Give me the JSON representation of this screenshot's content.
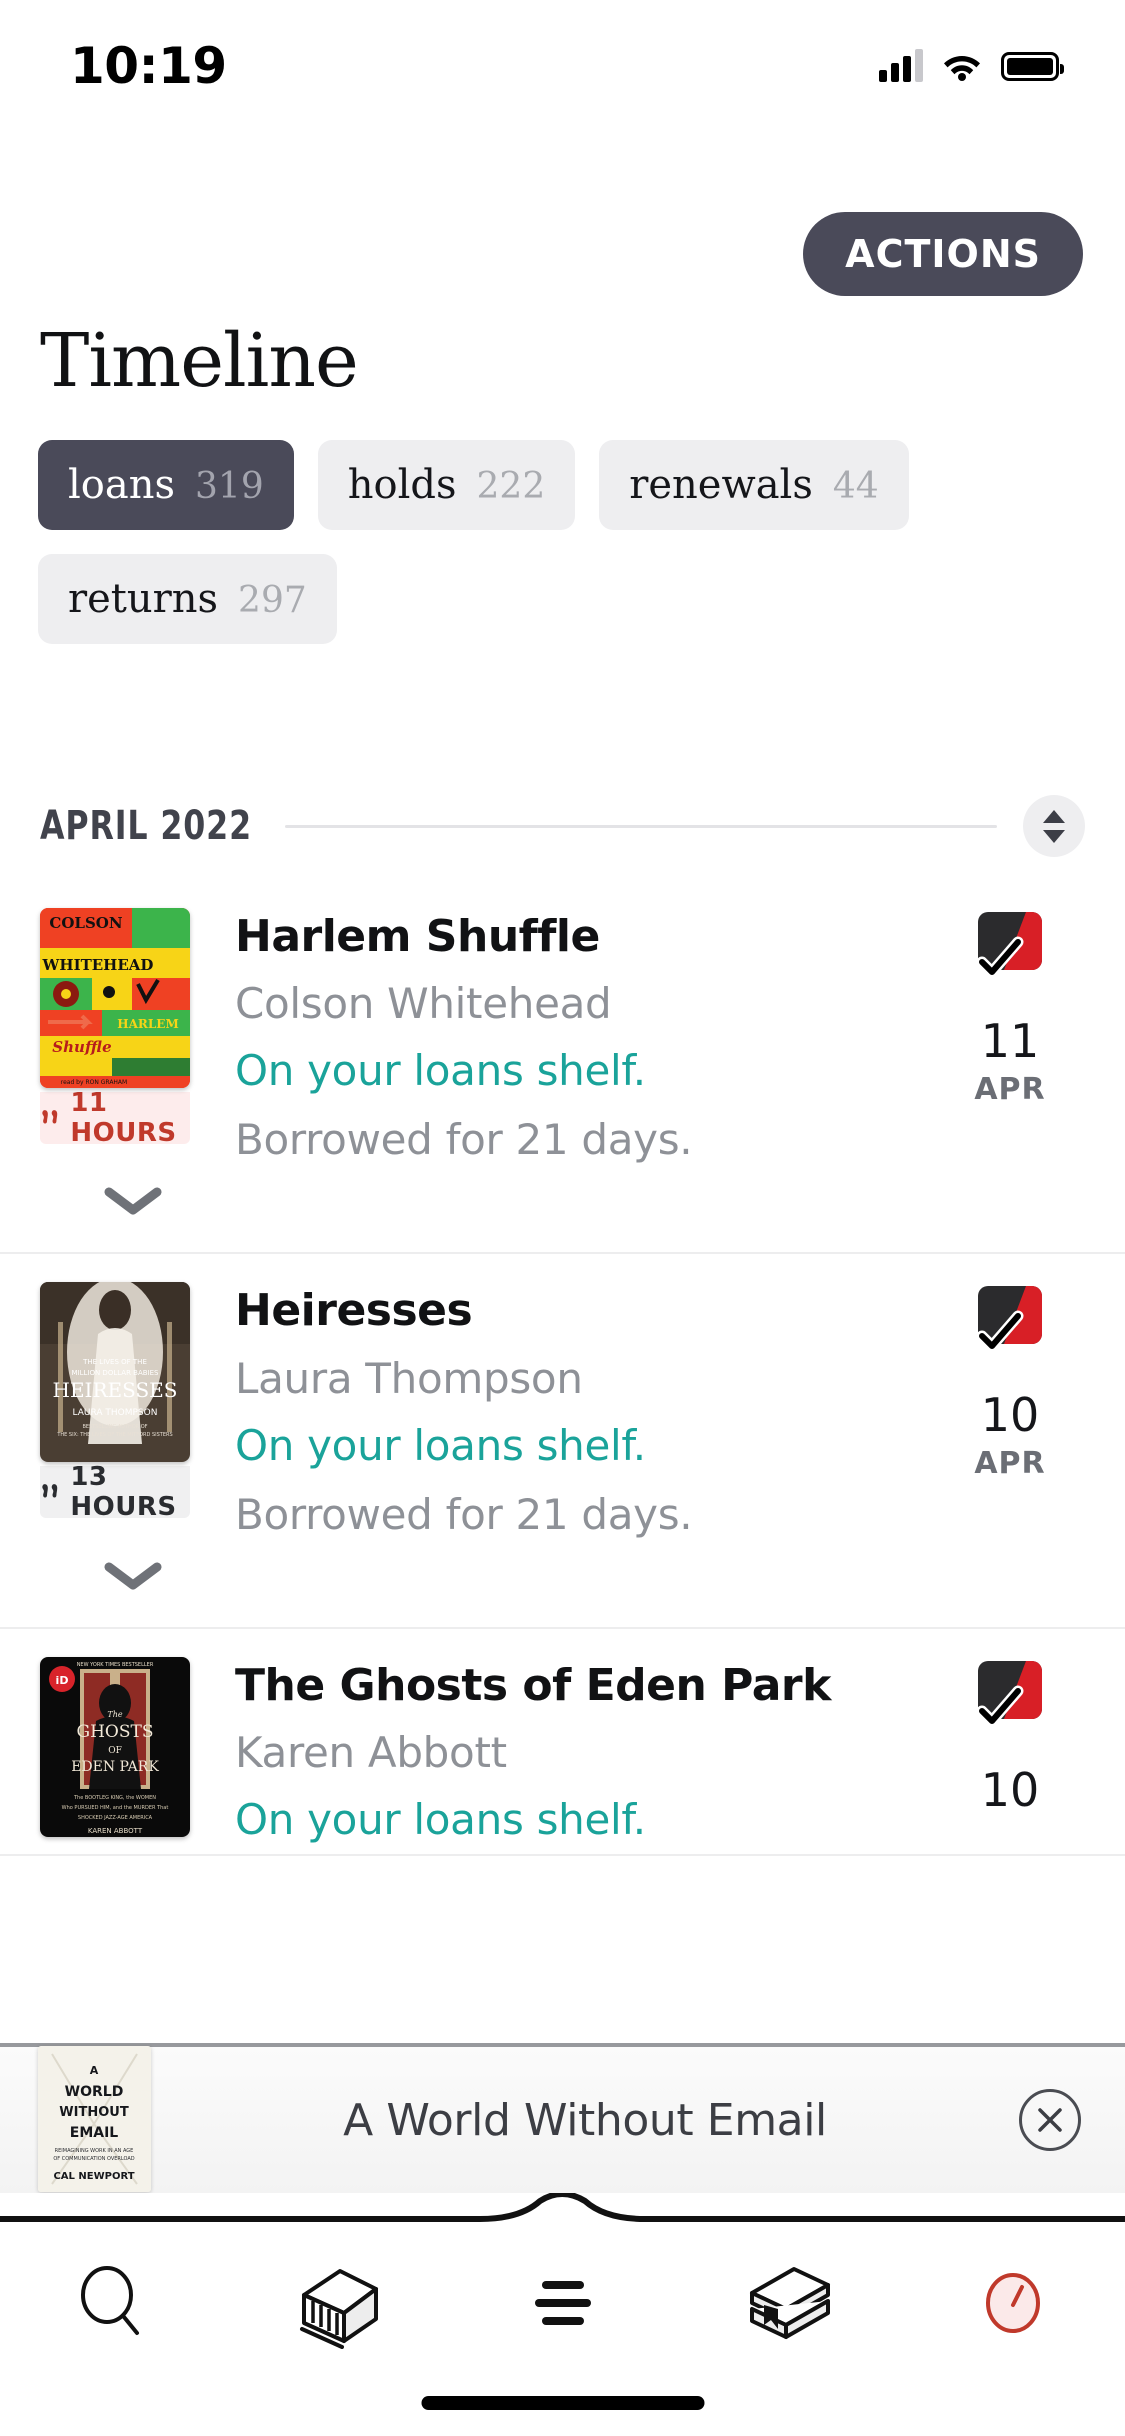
{
  "status_bar": {
    "time": "10:19",
    "cellular_icon": "signal-bars-icon",
    "wifi_icon": "wifi-icon",
    "battery_icon": "battery-icon"
  },
  "header": {
    "actions_label": "ACTIONS",
    "page_title": "Timeline"
  },
  "filters": [
    {
      "label": "loans",
      "count": "319",
      "active": true
    },
    {
      "label": "holds",
      "count": "222",
      "active": false
    },
    {
      "label": "renewals",
      "count": "44",
      "active": false
    },
    {
      "label": "returns",
      "count": "297",
      "active": false
    }
  ],
  "section": {
    "title": "APRIL 2022",
    "sort_icon": "sort-updown-icon"
  },
  "entries": [
    {
      "title": "Harlem Shuffle",
      "author": "Colson Whitehead",
      "status": "On your loans shelf.",
      "note": "Borrowed for 21 days.",
      "duration": "11 HOURS",
      "duration_style": "red",
      "day": "11",
      "month": "APR",
      "badge_icon": "loan-check-badge-icon",
      "expand_icon": "chevron-down-icon",
      "cover": "harlem-shuffle-cover"
    },
    {
      "title": "Heiresses",
      "author": "Laura Thompson",
      "status": "On your loans shelf.",
      "note": "Borrowed for 21 days.",
      "duration": "13 HOURS",
      "duration_style": "grey",
      "day": "10",
      "month": "APR",
      "badge_icon": "loan-check-badge-icon",
      "expand_icon": "chevron-down-icon",
      "cover": "heiresses-cover"
    },
    {
      "title": "The Ghosts of Eden Park",
      "author": "Karen Abbott",
      "status": "On your loans shelf.",
      "note": "",
      "duration": "",
      "duration_style": "grey",
      "day": "10",
      "month": "",
      "badge_icon": "loan-check-badge-icon",
      "expand_icon": "chevron-down-icon",
      "cover": "ghosts-eden-park-cover"
    }
  ],
  "mini_player": {
    "title": "A World Without Email",
    "cover": "a-world-without-email-cover",
    "close_icon": "close-icon"
  },
  "tabbar": [
    {
      "icon": "search-icon",
      "active": false
    },
    {
      "icon": "library-icon",
      "active": false
    },
    {
      "icon": "menu-icon",
      "active": false
    },
    {
      "icon": "shelves-icon",
      "active": false
    },
    {
      "icon": "timeline-clock-icon",
      "active": true
    }
  ],
  "colors": {
    "accent_dark": "#4a4a59",
    "status_teal": "#1aa39a",
    "duration_red": "#c0392b",
    "chip_bg": "#eeeef0",
    "muted_text": "#8e9197",
    "active_tab": "#c0392b"
  }
}
